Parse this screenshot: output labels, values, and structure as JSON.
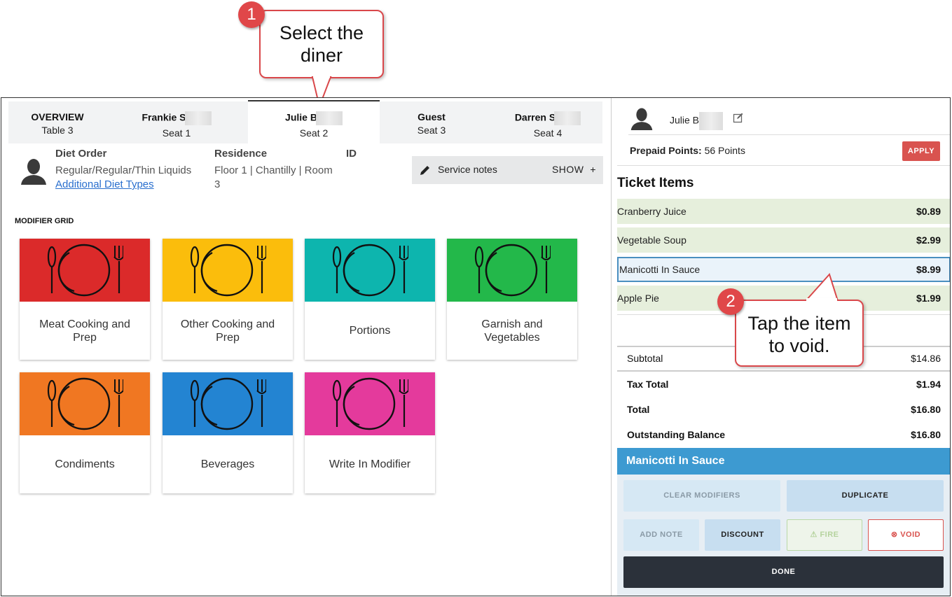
{
  "callouts": [
    {
      "number": "1",
      "text_line1": "Select the",
      "text_line2": "diner"
    },
    {
      "number": "2",
      "text_line1": "Tap the item",
      "text_line2": "to void."
    }
  ],
  "tabs": [
    {
      "name": "OVERVIEW",
      "sub": "Table 3"
    },
    {
      "name": "Frankie S",
      "sub": "Seat 1"
    },
    {
      "name": "Julie B",
      "sub": "Seat 2"
    },
    {
      "name": "Guest",
      "sub": "Seat 3"
    },
    {
      "name": "Darren S",
      "sub": "Seat 4"
    }
  ],
  "diner": {
    "diet_order_label": "Diet Order",
    "diet_order_value": "Regular/Regular/Thin Liquids",
    "additional_link": "Additional Diet Types",
    "residence_label": "Residence",
    "residence_line1": "Floor 1 | Chantilly | Room",
    "residence_line2": "3",
    "id_label": "ID"
  },
  "service_notes": {
    "label": "Service notes",
    "toggle": "SHOW",
    "plus": "+"
  },
  "modifier_grid": {
    "title": "MODIFIER GRID",
    "tiles": [
      {
        "label": "Meat Cooking and Prep",
        "color": "#db2a2a"
      },
      {
        "label": "Other Cooking and Prep",
        "color": "#fbbd0c"
      },
      {
        "label": "Portions",
        "color": "#0db5ae"
      },
      {
        "label": "Garnish and Vegetables",
        "color": "#23b84a"
      },
      {
        "label": "Condiments",
        "color": "#f07722"
      },
      {
        "label": "Beverages",
        "color": "#2384d2"
      },
      {
        "label": "Write In Modifier",
        "color": "#e43a9c"
      }
    ]
  },
  "right_panel": {
    "diner_name": "Julie B",
    "prepaid_label": "Prepaid Points:",
    "prepaid_value": "56 Points",
    "apply_label": "APPLY",
    "ticket_title": "Ticket Items",
    "items": [
      {
        "name": "Cranberry Juice",
        "price": "$0.89"
      },
      {
        "name": "Vegetable Soup",
        "price": "$2.99"
      },
      {
        "name": "Manicotti In Sauce",
        "price": "$8.99"
      },
      {
        "name": "Apple Pie",
        "price": "$1.99"
      }
    ],
    "totals": [
      {
        "label": "Subtotal",
        "value": "$14.86"
      },
      {
        "label": "Tax Total",
        "value": "$1.94"
      },
      {
        "label": "Total",
        "value": "$16.80"
      },
      {
        "label": "Outstanding Balance",
        "value": "$16.80"
      }
    ],
    "selected_item": "Manicotti In Sauce",
    "buttons": {
      "clear_modifiers": "CLEAR MODIFIERS",
      "duplicate": "DUPLICATE",
      "add_note": "ADD NOTE",
      "discount": "DISCOUNT",
      "fire": "FIRE",
      "void": "VOID",
      "done": "DONE"
    }
  }
}
